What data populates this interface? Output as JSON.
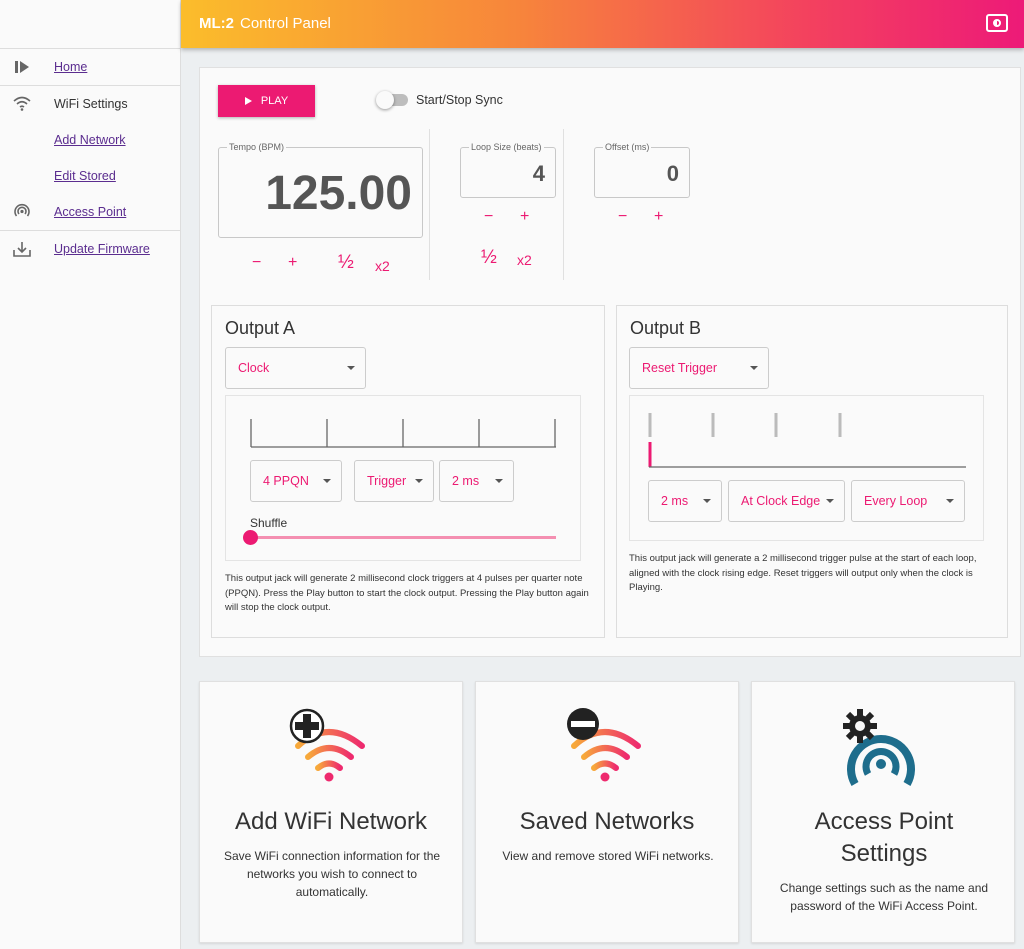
{
  "header": {
    "brand": "ML:2",
    "title": "Control Panel",
    "toggle_icon": "theme-toggle-icon"
  },
  "sidebar": {
    "items": [
      {
        "label": "Home",
        "icon": "play-pause-icon",
        "link": true
      },
      {
        "label": "WiFi Settings",
        "icon": "wifi-icon",
        "link": false
      },
      {
        "label": "Add Network",
        "icon": "",
        "link": true
      },
      {
        "label": "Edit Stored",
        "icon": "",
        "link": true
      },
      {
        "label": "Access Point",
        "icon": "access-point-icon",
        "link": true
      },
      {
        "label": "Update Firmware",
        "icon": "download-icon",
        "link": true
      }
    ]
  },
  "transport": {
    "play_label": "PLAY",
    "sync_label": "Start/Stop Sync"
  },
  "tempo": {
    "label": "Tempo (BPM)",
    "value": "125.00",
    "minus": "−",
    "plus": "+",
    "half": "½",
    "double": "x2"
  },
  "loop": {
    "label": "Loop Size (beats)",
    "value": "4",
    "minus": "−",
    "plus": "+",
    "half": "½",
    "double": "x2"
  },
  "offset": {
    "label": "Offset (ms)",
    "value": "0",
    "minus": "−",
    "plus": "+"
  },
  "output_a": {
    "title": "Output A",
    "mode": "Clock",
    "ppqn": "4 PPQN",
    "type": "Trigger",
    "width": "2 ms",
    "shuffle_label": "Shuffle",
    "shuffle_value": 0,
    "description": "This output jack will generate 2 millisecond clock triggers at 4 pulses per quarter note (PPQN). Press the Play button to start the clock output. Pressing the Play button again will stop the clock output."
  },
  "output_b": {
    "title": "Output B",
    "mode": "Reset Trigger",
    "width": "2 ms",
    "timing": "At Clock Edge",
    "frequency": "Every Loop",
    "description": "This output jack will generate a 2 millisecond trigger pulse at the start of each loop, aligned with the clock rising edge. Reset triggers will output only when the clock is Playing."
  },
  "cards": [
    {
      "title": "Add WiFi Network",
      "desc": "Save WiFi connection information for the networks you wish to connect to automatically.",
      "icon": "wifi-add-icon"
    },
    {
      "title": "Saved Networks",
      "desc": "View and remove stored WiFi networks.",
      "icon": "wifi-remove-icon"
    },
    {
      "title": "Access Point Settings",
      "desc": "Change settings such as the name and password of the WiFi Access Point.",
      "icon": "access-point-settings-icon"
    }
  ],
  "colors": {
    "accent": "#ec1a72",
    "header_start": "#fbbd2b",
    "header_end": "#ed1a78",
    "ap_blue": "#1e6d8c"
  }
}
